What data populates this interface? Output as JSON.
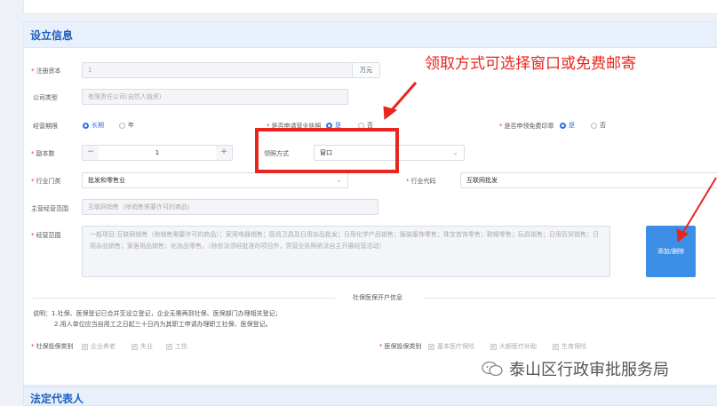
{
  "section": {
    "title": "设立信息"
  },
  "fields": {
    "registered_capital": {
      "label": "注册资本",
      "value": "1",
      "suffix": "万元"
    },
    "company_type": {
      "label": "公司类型",
      "value": "有限责任公司(自然人独资)"
    },
    "term": {
      "label": "经营期限",
      "opt_long": "长期",
      "opt_year": "年"
    },
    "license_option": {
      "label": "是否申请营业执照",
      "yes": "是",
      "no": "否"
    },
    "free_seal": {
      "label": "是否申领免费印章",
      "yes": "是",
      "no": "否"
    },
    "copies": {
      "label": "副本数",
      "minus": "−",
      "value": "1",
      "plus": "+"
    },
    "pickup": {
      "label": "领照方式",
      "value": "窗口"
    },
    "industry": {
      "label": "行业门类",
      "value": "批发和零售业"
    },
    "industry_code": {
      "label": "行业代码",
      "value": "互联网批发"
    },
    "main_scope": {
      "label": "主营经营范围",
      "value": "互联网销售（除销售需要许可的商品）"
    },
    "scope": {
      "label": "经营范围",
      "text": "一般项目:互联网销售（除销售需要许可的商品）；家用电器销售；厨具卫具及日用杂品批发；日用化学产品销售；服装服饰零售；珠宝首饰零售；鞋帽零售；玩具销售；日用百货销售；日用杂品销售；家居用品销售；化妆品零售。（除依法须经批准的项目外，凭营业执照依法自主开展经营活动）",
      "button": "添加/删除"
    }
  },
  "social": {
    "divider_title": "社保医保开户信息",
    "note_line1": "说明：1.社保、医保登记已合并至设立登记，企业无需再到社保、医保部门办理相关登记；",
    "note_line2": "2.用人单位应当自用工之日起三十日内为其职工申请办理职工社保、医保登记。",
    "insurance_label": "社保投保类别",
    "insurance_items": [
      "企业养老",
      "失业",
      "工伤"
    ],
    "medical_label": "医保投保类别",
    "medical_items": [
      "基本医疗保险",
      "大额医疗补助",
      "生育保险"
    ]
  },
  "annotation": "领取方式可选择窗口或免费邮寄",
  "next_section": {
    "title": "法定代表人"
  },
  "watermark": "泰山区行政审批服务局",
  "colors": {
    "accent": "#2b73e0",
    "annotation": "#e8261f",
    "section_bg": "#e8f0fb"
  }
}
